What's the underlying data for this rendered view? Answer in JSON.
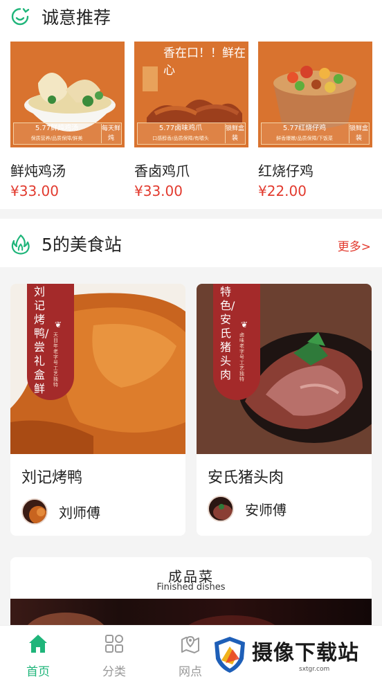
{
  "recommend": {
    "title": "诚意推荐",
    "items": [
      {
        "name": "鲜炖鸡汤",
        "price": "¥33.00",
        "img_label": "5.77鲜炖鸡汤",
        "img_sub": "保质营养/品质保障/鲜美",
        "img_tag": "每天鲜炖"
      },
      {
        "name": "香卤鸡爪",
        "price": "¥33.00",
        "img_label": "5.77卤味鸡爪",
        "img_sub": "口感醇香/品质保障/有嚼头",
        "img_tag": "锁鲜盒装",
        "img_headline": "香在口！！鲜在心"
      },
      {
        "name": "红烧仔鸡",
        "price": "¥22.00",
        "img_label": "5.77红烧仔鸡",
        "img_sub": "鲜香爆嫩/品质保障/下饭菜",
        "img_tag": "锁鲜盒装"
      }
    ]
  },
  "food_station": {
    "title": "5的美食站",
    "more": "更多>",
    "shops": [
      {
        "name": "刘记烤鸭",
        "chef": "刘师傅",
        "ribbon": "刘记烤鸭/尝礼盒鲜",
        "ribbon_sub": "天目年老字号工艺独特"
      },
      {
        "name": "安氏猪头肉",
        "chef": "安师傅",
        "ribbon": "特色/安氏猪头肉",
        "ribbon_sub": "卤味老字号工艺独特"
      }
    ]
  },
  "finished": {
    "title": "成品菜",
    "subtitle": "Finished dishes"
  },
  "tabbar": {
    "tabs": [
      {
        "label": "首页",
        "icon": "home-icon"
      },
      {
        "label": "分类",
        "icon": "category-icon"
      },
      {
        "label": "网点",
        "icon": "location-icon"
      }
    ]
  },
  "watermark": {
    "text": "摄像下载站",
    "url": "sxtgr.com"
  },
  "colors": {
    "accent_green": "#1fb57a",
    "price_red": "#e23a2e",
    "ribbon_red": "#a42a2a",
    "card_orange": "#d9732f"
  }
}
